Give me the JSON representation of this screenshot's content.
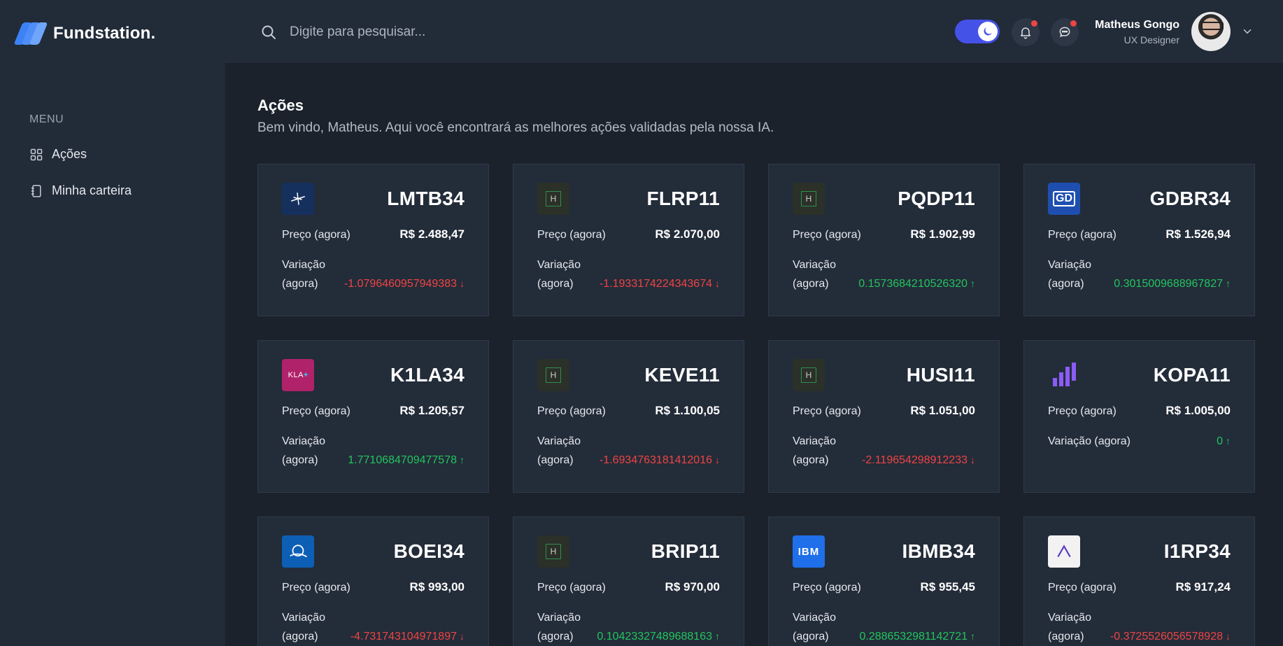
{
  "brand": {
    "name": "Fundstation."
  },
  "search": {
    "placeholder": "Digite para pesquisar..."
  },
  "user": {
    "name": "Matheus Gongo",
    "role": "UX Designer"
  },
  "sidebar": {
    "menu_label": "MENU",
    "items": [
      {
        "label": "Ações",
        "icon": "grid-icon"
      },
      {
        "label": "Minha carteira",
        "icon": "wallet-icon"
      }
    ]
  },
  "page": {
    "title": "Ações",
    "subtitle": "Bem vindo, Matheus. Aqui você encontrará as melhores ações validadas pela nossa IA."
  },
  "labels": {
    "price": "Preço (agora)",
    "variation_line1": "Variação",
    "variation_line2": "(agora)",
    "variation_single": "Variação (agora)"
  },
  "colors": {
    "accent": "#4552e8",
    "negative": "#ef4444",
    "positive": "#22c55e",
    "notification": "#ef4444"
  },
  "stocks": [
    {
      "ticker": "LMTB34",
      "price": "R$ 2.488,47",
      "variation": "-1.0796460957949383",
      "direction": "down",
      "logo": "lockheed-logo",
      "logo_text": "",
      "logo_bg": "#16305e"
    },
    {
      "ticker": "FLRP11",
      "price": "R$ 2.070,00",
      "variation": "-1.1933174224343674",
      "direction": "down",
      "logo": "h-placeholder-logo",
      "logo_text": "H",
      "logo_bg": "#2b3029"
    },
    {
      "ticker": "PQDP11",
      "price": "R$ 1.902,99",
      "variation": "0.1573684210526320",
      "direction": "up",
      "logo": "h-placeholder-logo",
      "logo_text": "H",
      "logo_bg": "#2b3029"
    },
    {
      "ticker": "GDBR34",
      "price": "R$ 1.526,94",
      "variation": "0.3015009688967827",
      "direction": "up",
      "logo": "gd-logo",
      "logo_text": "GD",
      "logo_bg": "#1e4fb0"
    },
    {
      "ticker": "K1LA34",
      "price": "R$ 1.205,57",
      "variation": "1.7710684709477578",
      "direction": "up",
      "logo": "kla-logo",
      "logo_text": "KLA",
      "logo_bg": "#b0226a"
    },
    {
      "ticker": "KEVE11",
      "price": "R$ 1.100,05",
      "variation": "-1.6934763181412016",
      "direction": "down",
      "logo": "h-placeholder-logo",
      "logo_text": "H",
      "logo_bg": "#2b3029"
    },
    {
      "ticker": "HUSI11",
      "price": "R$ 1.051,00",
      "variation": "-2.119654298912233",
      "direction": "down",
      "logo": "h-placeholder-logo",
      "logo_text": "H",
      "logo_bg": "#2b3029"
    },
    {
      "ticker": "KOPA11",
      "price": "R$ 1.005,00",
      "variation": "0",
      "direction": "up",
      "logo": "kopa-logo",
      "logo_text": "",
      "logo_bg": "#232c39",
      "single_line": true
    },
    {
      "ticker": "BOEI34",
      "price": "R$ 993,00",
      "variation": "-4.731743104971897",
      "direction": "down",
      "logo": "boeing-logo",
      "logo_text": "",
      "logo_bg": "#0d5fb5"
    },
    {
      "ticker": "BRIP11",
      "price": "R$ 970,00",
      "variation": "0.10423327489688163",
      "direction": "up",
      "logo": "h-placeholder-logo",
      "logo_text": "H",
      "logo_bg": "#2b3029"
    },
    {
      "ticker": "IBMB34",
      "price": "R$ 955,45",
      "variation": "0.2886532981142721",
      "direction": "up",
      "logo": "ibm-logo",
      "logo_text": "IBM",
      "logo_bg": "#1f6feb"
    },
    {
      "ticker": "I1RP34",
      "price": "R$ 917,24",
      "variation": "-0.3725526056578928",
      "direction": "down",
      "logo": "irobot-logo",
      "logo_text": "",
      "logo_bg": "#f2f2f2"
    }
  ]
}
